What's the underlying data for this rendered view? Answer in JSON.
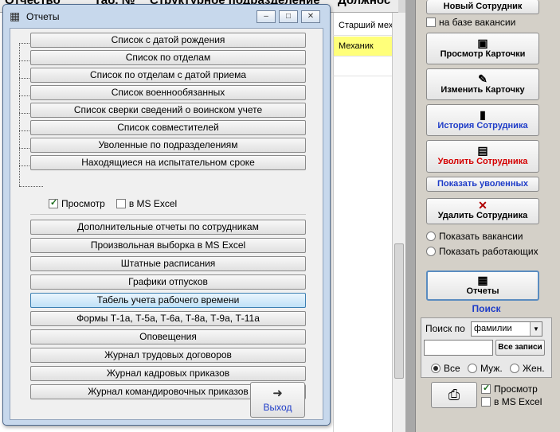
{
  "background_table": {
    "header_cols": [
      "Отчество",
      "Таб. №",
      "Структурное подразделение",
      "Должнос"
    ],
    "cells": [
      "Старший мех",
      "Механик"
    ]
  },
  "right_panel": {
    "new_employee": "Новый Сотрудник",
    "vacancy_check": "на базе вакансии",
    "view_card": "Просмотр Карточки",
    "edit_card": "Изменить Карточку",
    "history": "История Сотрудника",
    "dismiss": "Уволить Сотрудника",
    "show_dismissed": "Показать уволенных",
    "delete_employee": "Удалить Сотрудника",
    "show_vacancies": "Показать вакансии",
    "show_working": "Показать работающих",
    "reports": "Отчеты",
    "search_title": "Поиск",
    "search_by_label": "Поиск по",
    "search_by_value": "фамилии",
    "all_records": "Все записи",
    "filter_all": "Все",
    "filter_male": "Муж.",
    "filter_female": "Жен.",
    "preview": "Просмотр",
    "ms_excel": "в MS Excel"
  },
  "dialog": {
    "title": "Отчеты",
    "group1": [
      "Список с датой рождения",
      "Список по отделам",
      "Список по отделам с датой приема",
      "Список военнообязанных",
      "Список сверки сведений о воинском учете",
      "Список совместителей",
      "Уволенные по подразделениям",
      "Находящиеся на испытательном сроке"
    ],
    "preview": "Просмотр",
    "ms_excel": "в MS Excel",
    "group2": [
      "Дополнительные отчеты по сотрудникам",
      "Произвольная выборка в MS Excel",
      "Штатные расписания",
      "Графики отпусков",
      "Табель учета рабочего времени",
      "Формы Т-1а, Т-5а, Т-6а, Т-8а, Т-9а, Т-11а",
      "Оповещения",
      "Журнал трудовых договоров",
      "Журнал кадровых приказов",
      "Журнал командировочных приказов"
    ],
    "exit": "Выход"
  }
}
